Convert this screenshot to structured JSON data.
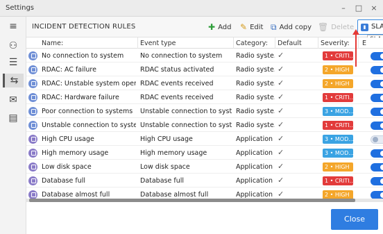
{
  "window": {
    "title": "Settings",
    "minimize": "–",
    "maximize": "□",
    "close": "×"
  },
  "sidebar": {
    "icons": [
      "menu-icon",
      "hierarchy-icon",
      "list-icon",
      "rules-icon",
      "mail-icon",
      "comment-icon"
    ]
  },
  "toolbar": {
    "title": "INCIDENT DETECTION RULES",
    "add_label": "Add",
    "edit_label": "Edit",
    "add_copy_label": "Add copy",
    "delete_label": "Delete",
    "sla_label": "SLA",
    "sla_tooltip": "SLA"
  },
  "table": {
    "headers": {
      "name": "Name:",
      "event": "Event type",
      "category": "Category:",
      "default": "Default",
      "severity": "Severity:",
      "enabled": "E"
    },
    "rows": [
      {
        "name": "No connection to system",
        "event": "No connection to system",
        "category": "Radio syste...",
        "default": "✓",
        "severity": "1 • CRITI...",
        "sevColor": "#e23b3b",
        "enabled": true,
        "iconType": "radio"
      },
      {
        "name": "RDAC: AC failure",
        "event": "RDAC status activated",
        "category": "Radio syste...",
        "default": "✓",
        "severity": "2 • HIGH",
        "sevColor": "#f4a62a",
        "enabled": true,
        "iconType": "radio"
      },
      {
        "name": "RDAC: Unstable system operat",
        "event": "RDAC events received",
        "category": "Radio syste...",
        "default": "✓",
        "severity": "2 • HIGH",
        "sevColor": "#f4a62a",
        "enabled": true,
        "iconType": "radio"
      },
      {
        "name": "RDAC: Hardware failure",
        "event": "RDAC events received",
        "category": "Radio syste...",
        "default": "✓",
        "severity": "1 • CRITI...",
        "sevColor": "#e23b3b",
        "enabled": true,
        "iconType": "radio"
      },
      {
        "name": "Poor connection to systems",
        "event": "Unstable connection to syst...",
        "category": "Radio syste...",
        "default": "✓",
        "severity": "3 • MOD...",
        "sevColor": "#3aa3e3",
        "enabled": true,
        "iconType": "radio"
      },
      {
        "name": "Unstable connection to systen",
        "event": "Unstable connection to syst...",
        "category": "Radio syste...",
        "default": "✓",
        "severity": "1 • CRITI...",
        "sevColor": "#e23b3b",
        "enabled": true,
        "iconType": "radio"
      },
      {
        "name": "High CPU usage",
        "event": "High CPU usage",
        "category": "Application",
        "default": "✓",
        "severity": "3 • MOD...",
        "sevColor": "#3aa3e3",
        "enabled": false,
        "iconType": "app"
      },
      {
        "name": "High memory usage",
        "event": "High memory usage",
        "category": "Application",
        "default": "✓",
        "severity": "3 • MOD...",
        "sevColor": "#3aa3e3",
        "enabled": true,
        "iconType": "app"
      },
      {
        "name": "Low disk space",
        "event": "Low disk space",
        "category": "Application",
        "default": "✓",
        "severity": "2 • HIGH",
        "sevColor": "#f4a62a",
        "enabled": true,
        "iconType": "app"
      },
      {
        "name": "Database full",
        "event": "Database full",
        "category": "Application",
        "default": "✓",
        "severity": "1 • CRITI...",
        "sevColor": "#e23b3b",
        "enabled": true,
        "iconType": "app"
      },
      {
        "name": "Database almost full",
        "event": "Database almost full",
        "category": "Application",
        "default": "✓",
        "severity": "2 • HIGH",
        "sevColor": "#f4a62a",
        "enabled": true,
        "iconType": "app"
      }
    ]
  },
  "footer": {
    "close_label": "Close"
  },
  "colors": {
    "accent": "#2f7de1",
    "annotation_arrow": "#e53935"
  }
}
